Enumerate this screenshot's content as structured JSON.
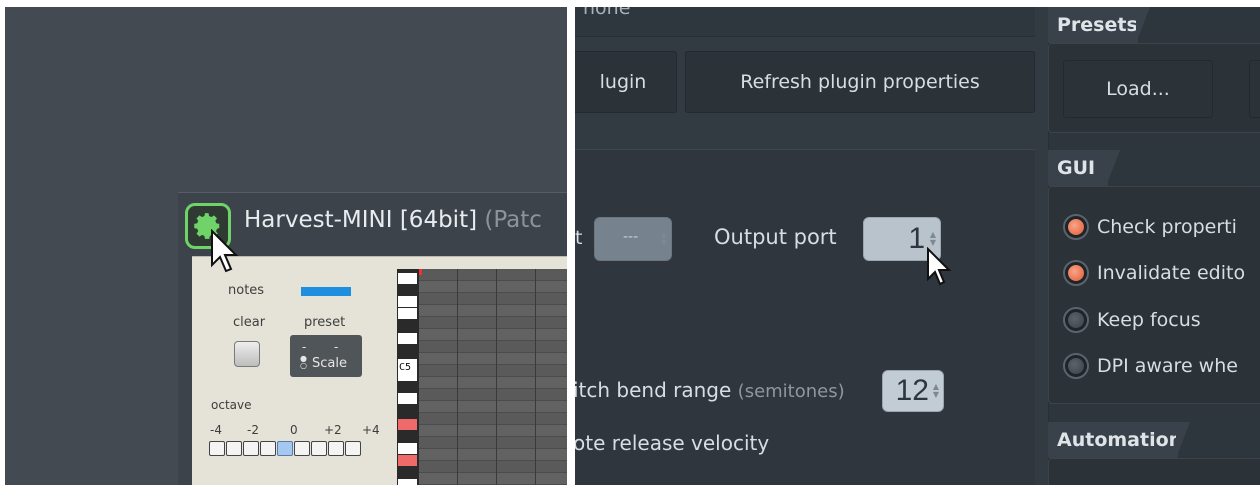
{
  "left": {
    "plugin_title": "Harvest-MINI [64bit]",
    "plugin_title_suffix": " (Patc",
    "labels": {
      "notes": "notes",
      "clear": "clear",
      "preset": "preset",
      "preset_dash_left": "-",
      "preset_dash_right": "-",
      "preset_value": "Scale",
      "octave": "octave",
      "c5": "C5"
    },
    "octave_values": [
      "-4",
      "-2",
      "0",
      "+2",
      "+4"
    ],
    "notes_color": "#1e8fe0",
    "accent_color": "#6fd36a"
  },
  "right": {
    "top_text": "none",
    "buttons": {
      "plugin": "lugin",
      "refresh": "Refresh plugin properties",
      "load": "Load..."
    },
    "tabs": {
      "presets": "Presets",
      "gui": "GUI",
      "automation": "Automation"
    },
    "fields": {
      "disabled_suffix": "t",
      "disabled_value": "---",
      "output_port_label": "Output port",
      "output_port_value": "1",
      "pitch_bend_label": "itch bend range",
      "pitch_bend_unit": "(semitones)",
      "pitch_bend_value": "12",
      "note_release": "ote release velocity"
    },
    "gui_options": [
      {
        "label": "Check properti",
        "checked": true
      },
      {
        "label": "Invalidate edito",
        "checked": true
      },
      {
        "label": "Keep focus",
        "checked": false
      },
      {
        "label": "DPI aware whe",
        "checked": false
      }
    ],
    "radio_on_color": "#e35a33"
  }
}
